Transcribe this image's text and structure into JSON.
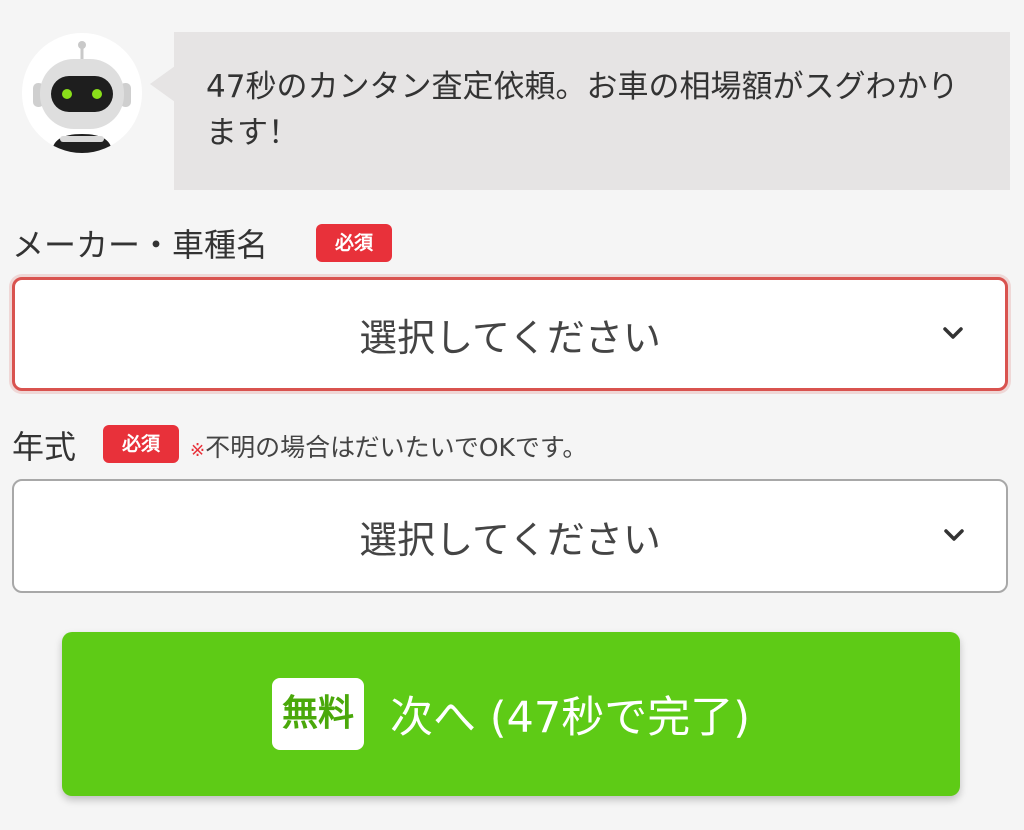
{
  "bubble": {
    "message": "47秒のカンタン査定依頼。お車の相場額がスグわかります！"
  },
  "fields": {
    "maker": {
      "label": "メーカー・車種名",
      "required_badge": "必須",
      "selected_value": "選択してください"
    },
    "year": {
      "label": "年式",
      "required_badge": "必須",
      "note_mark": "※",
      "note": "不明の場合はだいたいでOKです。",
      "selected_value": "選択してください"
    }
  },
  "cta": {
    "free_label": "無料",
    "label": "次へ (47秒で完了)"
  },
  "colors": {
    "accent_green": "#5ecb16",
    "required_red": "#e8313a",
    "error_border": "#d9534f",
    "bubble_bg": "#e6e4e4"
  },
  "icons": {
    "avatar": "robot-avatar-icon",
    "select_arrow": "chevron-down-icon"
  }
}
